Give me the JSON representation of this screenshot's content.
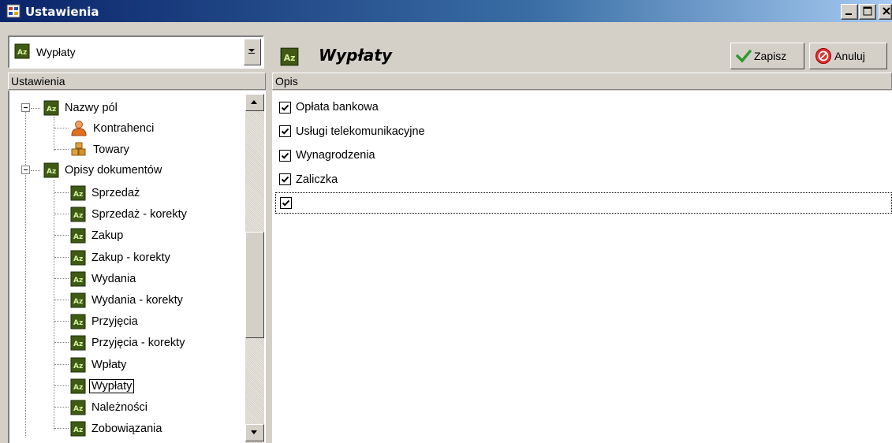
{
  "window": {
    "title": "Ustawienia"
  },
  "combo": {
    "value": "Wypłaty"
  },
  "left_header": "Ustawienia",
  "tree": {
    "groups": [
      {
        "label": "Nazwy pól",
        "children": [
          "Kontrahenci",
          "Towary"
        ]
      },
      {
        "label": "Opisy dokumentów",
        "children": [
          "Sprzedaż",
          "Sprzedaż - korekty",
          "Zakup",
          "Zakup - korekty",
          "Wydania",
          "Wydania - korekty",
          "Przyjęcia",
          "Przyjęcia - korekty",
          "Wpłaty",
          "Wypłaty",
          "Należności",
          "Zobowiązania"
        ]
      }
    ],
    "selected": "Wypłaty"
  },
  "right": {
    "title": "Wypłaty",
    "save_label": "Zapisz",
    "cancel_label": "Anuluj",
    "column_header": "Opis",
    "rows": [
      {
        "label": "Opłata bankowa",
        "checked": true
      },
      {
        "label": "Usługi telekomunikacyjne",
        "checked": true
      },
      {
        "label": "Wynagrodzenia",
        "checked": true
      },
      {
        "label": "Zaliczka",
        "checked": true
      },
      {
        "label": "",
        "checked": true
      }
    ]
  },
  "colors": {
    "title_start": "#0a246a",
    "title_end": "#a6caf0",
    "face": "#d4d0c8",
    "icon_green": "#4a6b1a"
  },
  "icons": {
    "az": "az-icon",
    "person": "person-icon",
    "boxes": "boxes-icon",
    "check": "check-icon",
    "cancel": "cancel-icon"
  }
}
